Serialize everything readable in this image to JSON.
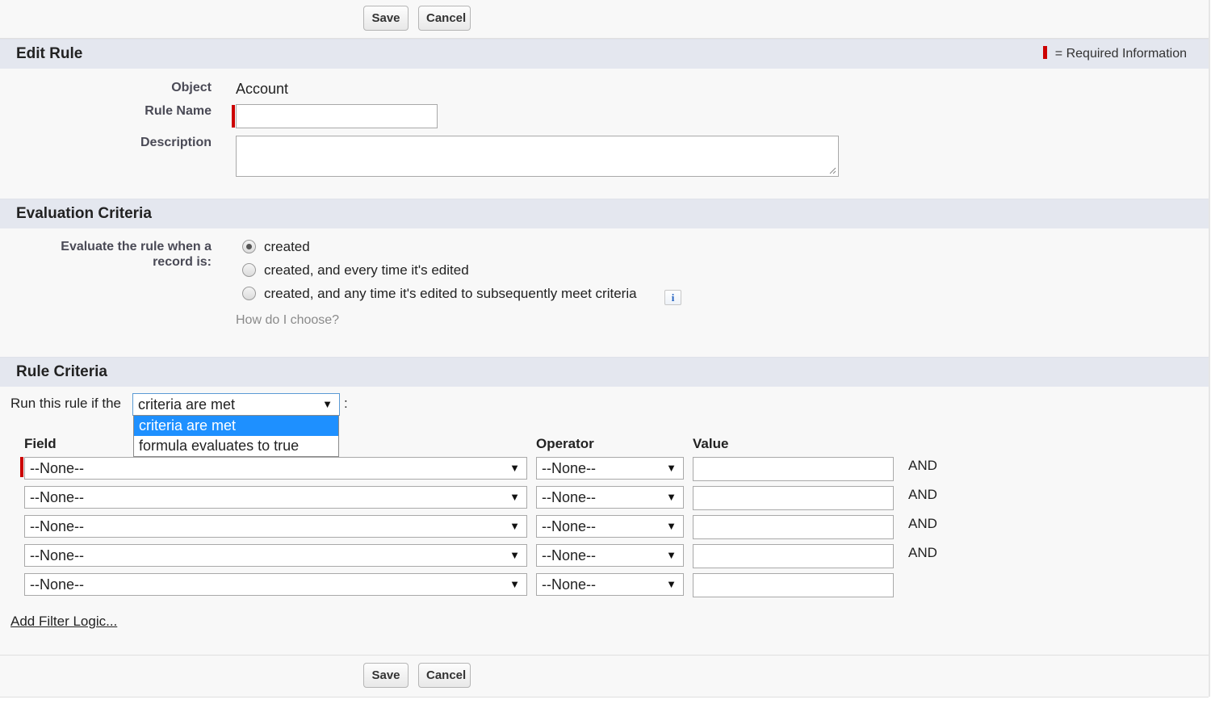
{
  "buttons": {
    "save": "Save",
    "cancel": "Cancel"
  },
  "colors": {
    "required": "#cc0000",
    "section_header_bg": "#e4e7ef",
    "dropdown_highlight": "#1e90ff"
  },
  "edit_rule": {
    "title": "Edit Rule",
    "required_legend": "= Required Information",
    "object_label": "Object",
    "object_value": "Account",
    "rule_name_label": "Rule Name",
    "rule_name_value": "",
    "description_label": "Description",
    "description_value": ""
  },
  "evaluation": {
    "title": "Evaluation Criteria",
    "prompt_line1": "Evaluate the rule when a",
    "prompt_line2": "record is:",
    "options": [
      {
        "label": "created",
        "checked": true
      },
      {
        "label": "created, and every time it's edited",
        "checked": false
      },
      {
        "label": "created, and any time it's edited to subsequently meet criteria",
        "checked": false
      }
    ],
    "info_icon": "info-icon",
    "info_glyph": "i",
    "help_link": "How do I choose?"
  },
  "rule_criteria": {
    "title": "Rule Criteria",
    "run_prefix": "Run this rule if the",
    "run_select_value": "criteria are met",
    "run_suffix": ":",
    "dropdown_options": [
      {
        "label": "criteria are met",
        "selected": true
      },
      {
        "label": "formula evaluates to true",
        "selected": false
      }
    ],
    "columns": {
      "field": "Field",
      "operator": "Operator",
      "value": "Value"
    },
    "rows": [
      {
        "field": "--None--",
        "operator": "--None--",
        "value": "",
        "conjunction": "AND"
      },
      {
        "field": "--None--",
        "operator": "--None--",
        "value": "",
        "conjunction": "AND"
      },
      {
        "field": "--None--",
        "operator": "--None--",
        "value": "",
        "conjunction": "AND"
      },
      {
        "field": "--None--",
        "operator": "--None--",
        "value": "",
        "conjunction": "AND"
      },
      {
        "field": "--None--",
        "operator": "--None--",
        "value": "",
        "conjunction": ""
      }
    ],
    "add_filter_logic": "Add Filter Logic..."
  },
  "arrow_glyph": "▼"
}
